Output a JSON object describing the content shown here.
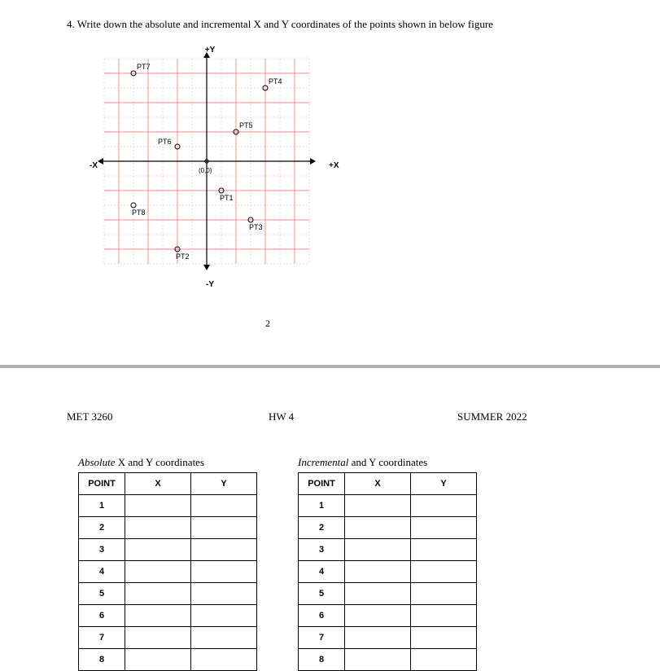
{
  "question": "4. Write down the absolute and incremental X and Y coordinates of the points shown in below figure",
  "page_number": "2",
  "axis": {
    "pos_y": "+Y",
    "neg_y": "-Y",
    "pos_x": "+X",
    "neg_x": "-X",
    "origin": "(0,0)"
  },
  "points": [
    {
      "name": "PT7",
      "gx": -5,
      "gy": 6,
      "lpos": "above"
    },
    {
      "name": "PT4",
      "gx": 4,
      "gy": 5,
      "lpos": "above"
    },
    {
      "name": "PT5",
      "gx": 2,
      "gy": 2,
      "lpos": "above"
    },
    {
      "name": "PT6",
      "gx": -2,
      "gy": 1,
      "lpos": "left"
    },
    {
      "name": "PT1",
      "gx": 1,
      "gy": -2,
      "lpos": "below"
    },
    {
      "name": "PT8",
      "gx": -5,
      "gy": -3,
      "lpos": "below"
    },
    {
      "name": "PT3",
      "gx": 3,
      "gy": -4,
      "lpos": "below"
    },
    {
      "name": "PT2",
      "gx": -2,
      "gy": -6,
      "lpos": "below"
    }
  ],
  "header": {
    "course": "MET 3260",
    "hw": "HW 4",
    "term": "SUMMER 2022"
  },
  "table_abs_title_i": "Absolute",
  "table_abs_title_r": " X and Y coordinates",
  "table_inc_title_i": "Incremental",
  "table_inc_title_r": " and Y coordinates",
  "cols": {
    "point": "POINT",
    "x": "X",
    "y": "Y"
  },
  "rows": [
    "1",
    "2",
    "3",
    "4",
    "5",
    "6",
    "7",
    "8"
  ]
}
